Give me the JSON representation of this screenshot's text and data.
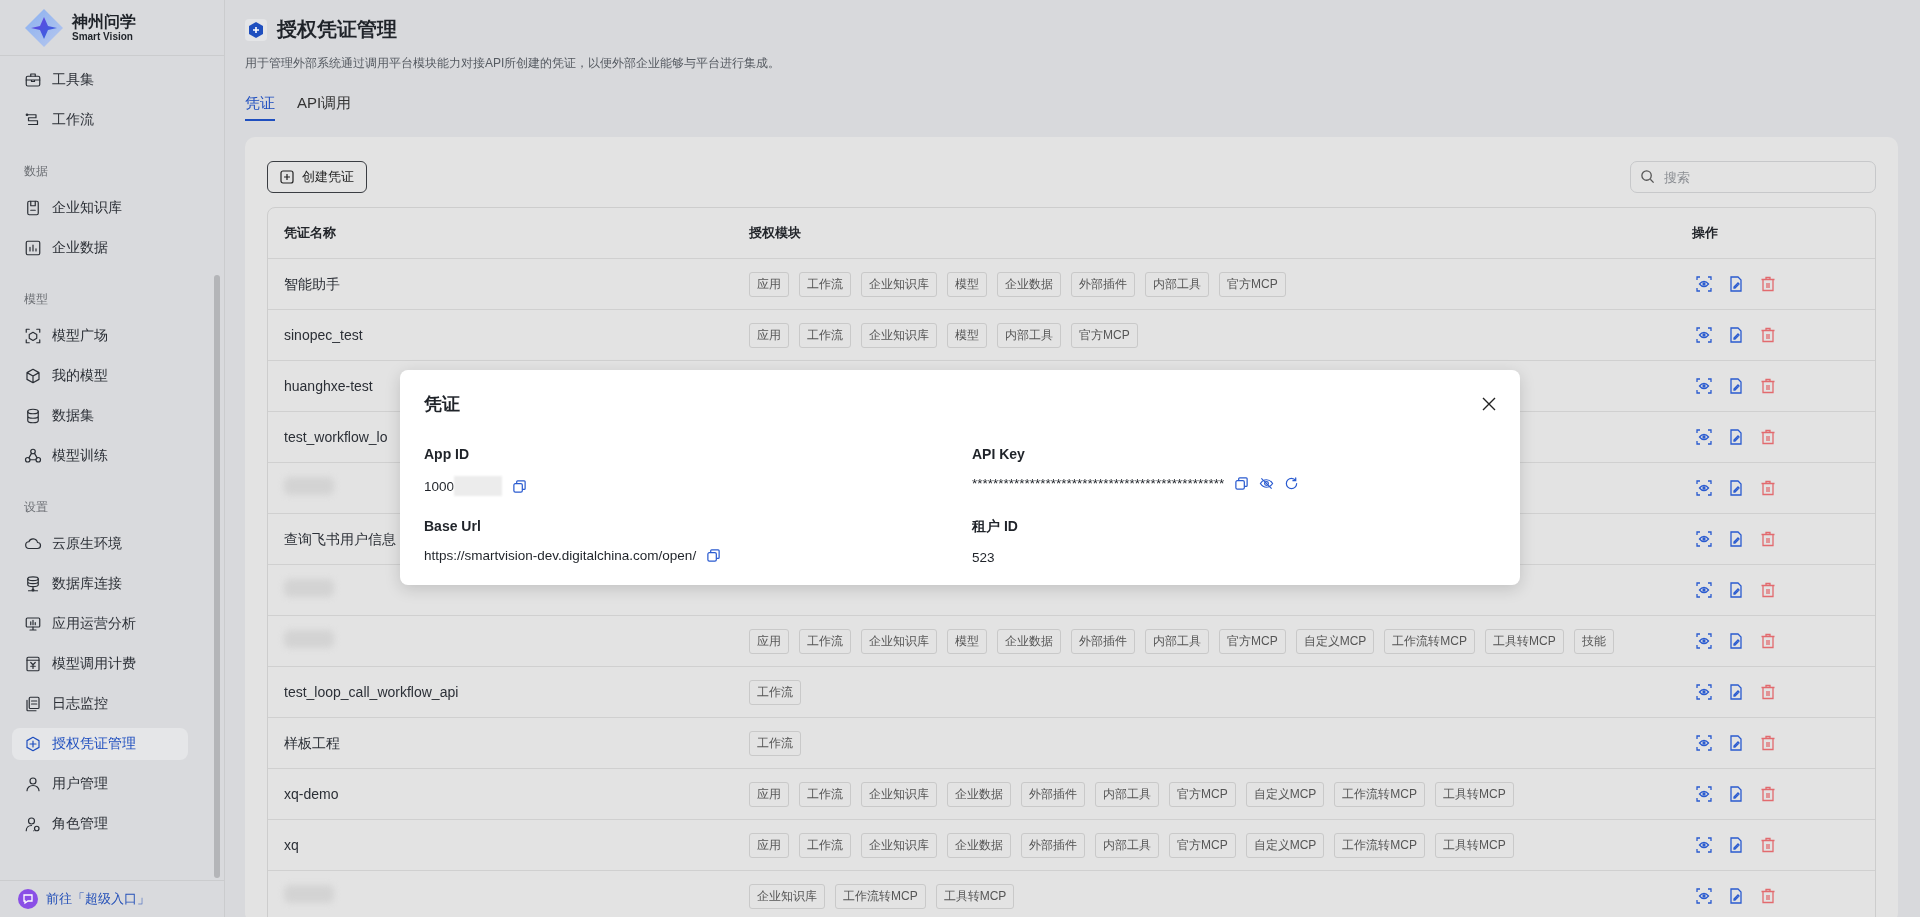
{
  "sidebar": {
    "logo": {
      "title": "神州问学",
      "subtitle": "Smart Vision"
    },
    "groups": [
      {
        "items": [
          {
            "label": "工具集",
            "selected": false
          },
          {
            "label": "工作流",
            "selected": false
          }
        ]
      },
      {
        "heading": "数据",
        "items": [
          {
            "label": "企业知识库",
            "selected": false
          },
          {
            "label": "企业数据",
            "selected": false
          }
        ]
      },
      {
        "heading": "模型",
        "items": [
          {
            "label": "模型广场",
            "selected": false
          },
          {
            "label": "我的模型",
            "selected": false
          },
          {
            "label": "数据集",
            "selected": false
          },
          {
            "label": "模型训练",
            "selected": false
          }
        ]
      },
      {
        "heading": "设置",
        "items": [
          {
            "label": "云原生环境",
            "selected": false
          },
          {
            "label": "数据库连接",
            "selected": false
          },
          {
            "label": "应用运营分析",
            "selected": false
          },
          {
            "label": "模型调用计费",
            "selected": false
          },
          {
            "label": "日志监控",
            "selected": false
          },
          {
            "label": "授权凭证管理",
            "selected": true
          },
          {
            "label": "用户管理",
            "selected": false
          },
          {
            "label": "角色管理",
            "selected": false
          }
        ]
      }
    ],
    "footer_link": "前往「超级入口」"
  },
  "page": {
    "title": "授权凭证管理",
    "description": "用于管理外部系统通过调用平台模块能力对接API所创建的凭证，以便外部企业能够与平台进行集成。"
  },
  "tabs": [
    {
      "label": "凭证",
      "selected": true
    },
    {
      "label": "API调用",
      "selected": false
    }
  ],
  "toolbar": {
    "create_button": "创建凭证",
    "search": {
      "placeholder": "搜索"
    }
  },
  "table": {
    "columns": [
      "凭证名称",
      "授权模块",
      "操作"
    ],
    "rows": [
      {
        "name": "智能助手",
        "modules": [
          "应用",
          "工作流",
          "企业知识库",
          "模型",
          "企业数据",
          "外部插件",
          "内部工具",
          "官方MCP"
        ]
      },
      {
        "name": "sinopec_test",
        "modules": [
          "应用",
          "工作流",
          "企业知识库",
          "模型",
          "内部工具",
          "官方MCP"
        ]
      },
      {
        "name": "huanghxe-test",
        "modules": []
      },
      {
        "name": "test_workflow_lo",
        "modules": []
      },
      {
        "redacted": true,
        "modules": []
      },
      {
        "name": "查询飞书用户信息",
        "modules": []
      },
      {
        "redacted": true,
        "modules": []
      },
      {
        "redacted": true,
        "modules": [
          "应用",
          "工作流",
          "企业知识库",
          "模型",
          "企业数据",
          "外部插件",
          "内部工具",
          "官方MCP",
          "自定义MCP",
          "工作流转MCP",
          "工具转MCP",
          "技能"
        ]
      },
      {
        "name": "test_loop_call_workflow_api",
        "modules": [
          "工作流"
        ]
      },
      {
        "name": "样板工程",
        "modules": [
          "工作流"
        ]
      },
      {
        "name": "xq-demo",
        "modules": [
          "应用",
          "工作流",
          "企业知识库",
          "企业数据",
          "外部插件",
          "内部工具",
          "官方MCP",
          "自定义MCP",
          "工作流转MCP",
          "工具转MCP"
        ]
      },
      {
        "name": "xq",
        "modules": [
          "应用",
          "工作流",
          "企业知识库",
          "企业数据",
          "外部插件",
          "内部工具",
          "官方MCP",
          "自定义MCP",
          "工作流转MCP",
          "工具转MCP"
        ]
      },
      {
        "redacted": true,
        "modules": [
          "企业知识库",
          "工作流转MCP",
          "工具转MCP"
        ]
      }
    ]
  },
  "dialog": {
    "title": "凭证",
    "fields": [
      {
        "label": "App ID",
        "value": "1000",
        "value_redacted": true,
        "kind": "copyable"
      },
      {
        "label": "API Key",
        "value": "************************************************",
        "kind": "secret"
      },
      {
        "label": "Base Url",
        "value": "https://smartvision-dev.digitalchina.com/open/",
        "kind": "copyable"
      },
      {
        "label": "租户 ID",
        "value": "523",
        "kind": "plain"
      }
    ]
  }
}
